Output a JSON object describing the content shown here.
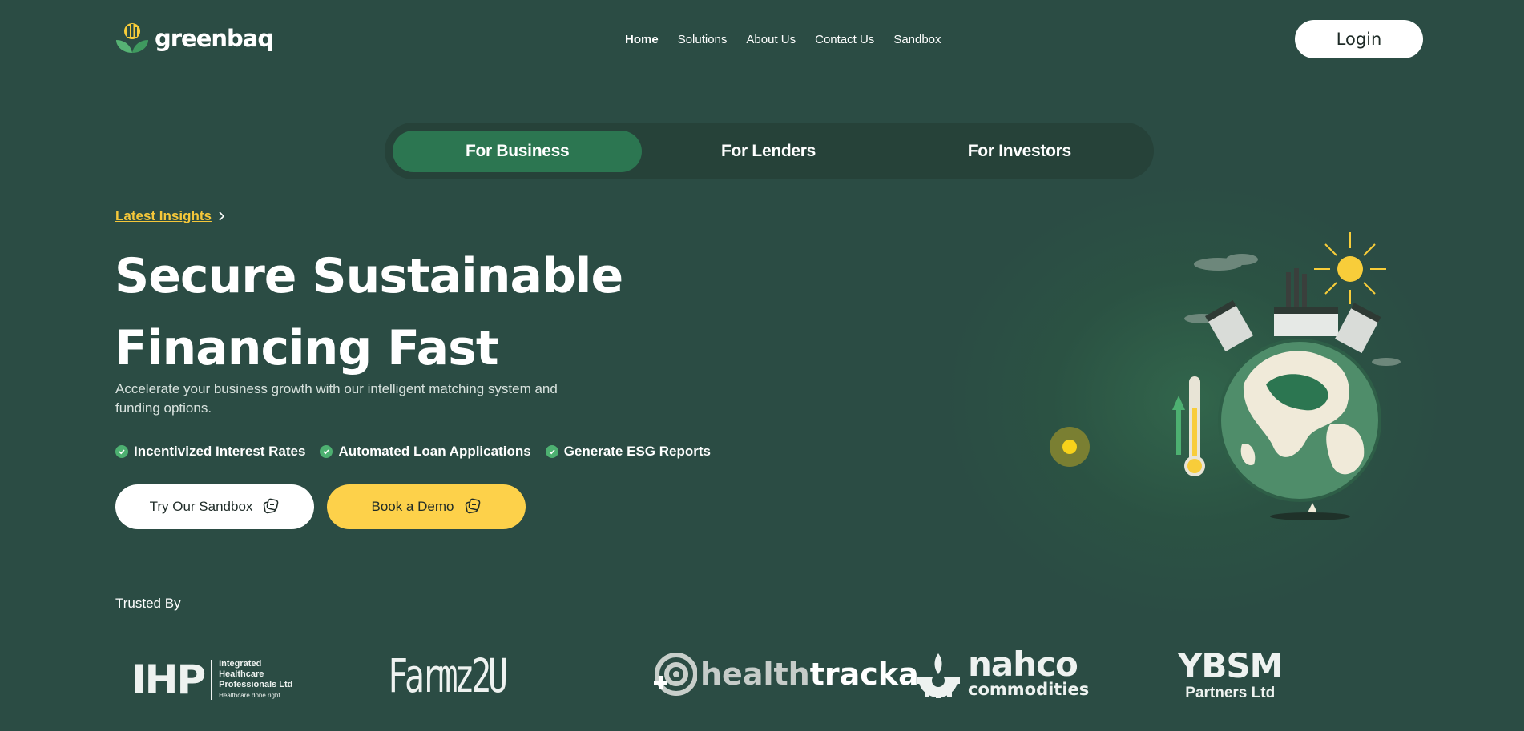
{
  "brand": {
    "name": "greenbaq"
  },
  "nav": {
    "items": [
      {
        "label": "Home",
        "active": true
      },
      {
        "label": "Solutions"
      },
      {
        "label": "About Us"
      },
      {
        "label": "Contact Us"
      },
      {
        "label": "Sandbox"
      }
    ],
    "login_label": "Login"
  },
  "tabs": [
    {
      "label": "For Business",
      "active": true
    },
    {
      "label": "For Lenders"
    },
    {
      "label": "For Investors"
    }
  ],
  "hero": {
    "insights_link": "Latest Insights",
    "headline_line1": "Secure Sustainable",
    "headline_line2": "Financing Fast",
    "subtitle": "Accelerate your business growth with our intelligent matching system and funding options.",
    "features": [
      "Incentivized Interest Rates",
      "Automated Loan Applications",
      "Generate ESG Reports"
    ],
    "sandbox_button": "Try Our Sandbox",
    "demo_button": "Book a Demo"
  },
  "trusted": {
    "label": "Trusted By",
    "partners": {
      "ihp": {
        "mark": "IHP",
        "line1": "Integrated",
        "line2": "Healthcare",
        "line3": "Professionals Ltd",
        "tagline": "Healthcare done right"
      },
      "farmz2u": {
        "name": "Farmz2U"
      },
      "healthtracka": {
        "part1": "health",
        "part2": "tracka"
      },
      "nahco": {
        "name": "nahco",
        "sub": "commodities"
      },
      "ybsm": {
        "name": "YBSM",
        "sub": "Partners Ltd"
      }
    }
  },
  "colors": {
    "background": "#2b4c44",
    "accent_green": "#2c7651",
    "accent_yellow": "#fdd14a",
    "insight_yellow": "#f5c73a"
  },
  "icons": [
    "chevron-right-icon",
    "check-circle-icon",
    "stack-icon",
    "earth-illustration"
  ]
}
